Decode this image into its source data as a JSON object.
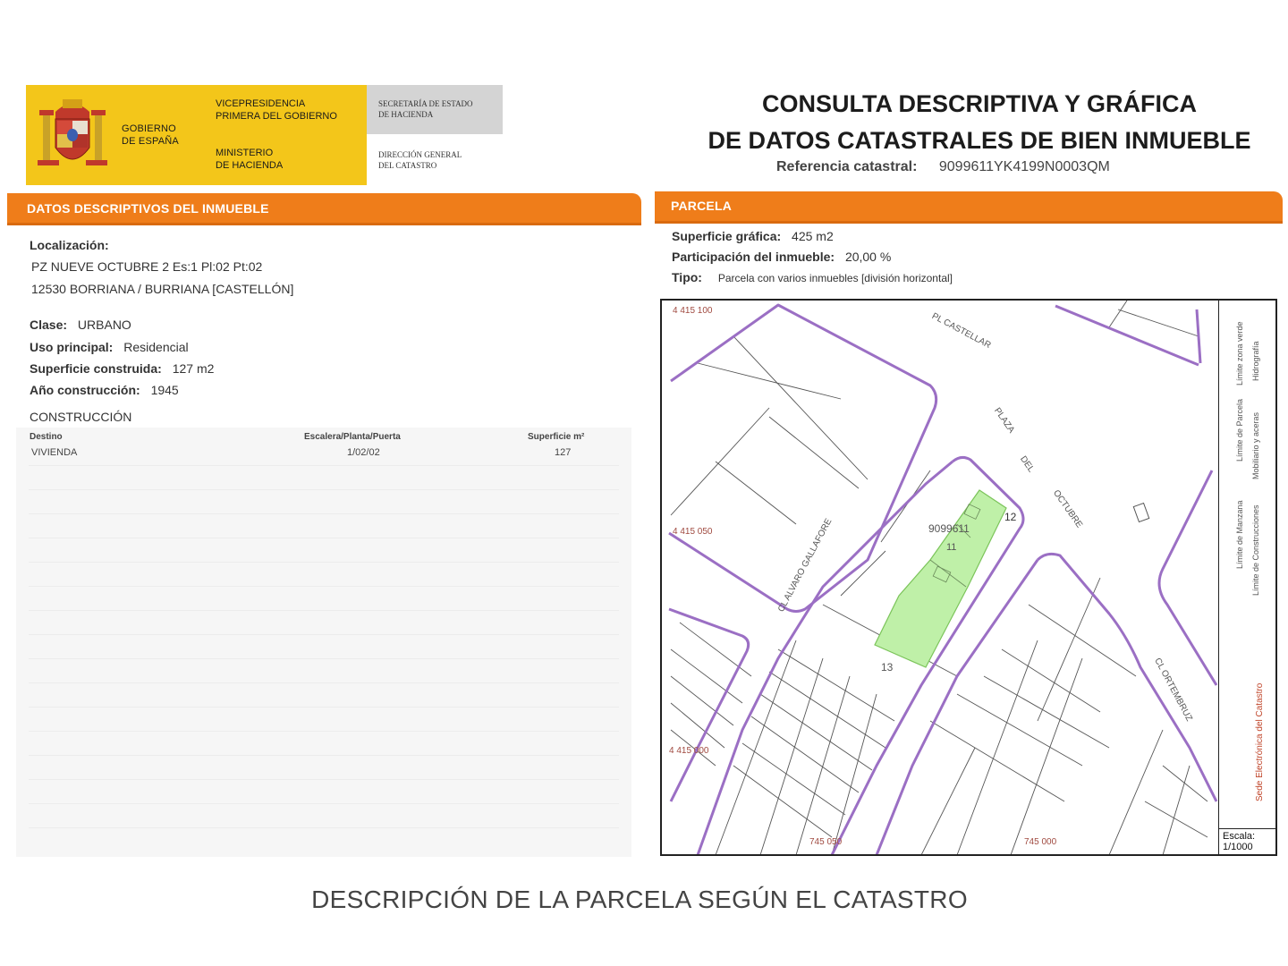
{
  "header": {
    "gov_line1": "GOBIERNO",
    "gov_line2": "DE ESPAÑA",
    "vice_line1": "VICEPRESIDENCIA",
    "vice_line2": "PRIMERA DEL GOBIERNO",
    "min_line1": "MINISTERIO",
    "min_line2": "DE HACIENDA",
    "sec_line1": "SECRETARÍA DE ESTADO",
    "sec_line2": "DE HACIENDA",
    "dir_line1": "DIRECCIÓN GENERAL",
    "dir_line2": "DEL CATASTRO",
    "colors": {
      "yellow": "#f3c61a",
      "grey": "#d4d4d4"
    }
  },
  "title": {
    "line1": "CONSULTA DESCRIPTIVA Y GRÁFICA",
    "line2": "DE DATOS CATASTRALES DE BIEN INMUEBLE",
    "ref_label": "Referencia catastral:",
    "ref_value": "9099611YK4199N0003QM"
  },
  "left": {
    "section_title": "DATOS DESCRIPTIVOS DEL INMUEBLE",
    "loc_label": "Localización:",
    "loc_line1": "PZ NUEVE OCTUBRE 2 Es:1 Pl:02 Pt:02",
    "loc_line2": "12530 BORRIANA / BURRIANA [CASTELLÓN]",
    "clase_label": "Clase:",
    "clase_value": "URBANO",
    "uso_label": "Uso principal:",
    "uso_value": "Residencial",
    "sup_label": "Superficie construida:",
    "sup_value": "127 m2",
    "ano_label": "Año construcción:",
    "ano_value": "1945",
    "constr_title": "CONSTRUCCIÓN",
    "table": {
      "headers": [
        "Destino",
        "Escalera/Planta/Puerta",
        "Superficie m²"
      ],
      "rows": [
        [
          "VIVIENDA",
          "1/02/02",
          "127"
        ]
      ]
    }
  },
  "right": {
    "section_title": "PARCELA",
    "sup_label": "Superficie gráfica:",
    "sup_value": "425 m2",
    "part_label": "Participación del inmueble:",
    "part_value": "20,00 %",
    "tipo_label": "Tipo:",
    "tipo_value": "Parcela con varios inmuebles [división horizontal]",
    "map": {
      "coord_top": "4 415 100",
      "coord_mid": "4 415 050",
      "coord_low": "4 415 000",
      "coord_b1": "745 050",
      "coord_b2": "745 000",
      "street_top": "PL CASTELLAR",
      "street_plaza_1": "PLAZA",
      "street_plaza_2": "DEL",
      "street_plaza_3": "OCTUBRE",
      "street_left": "CL ALVARO GALLAFORE",
      "street_right": "CL ORTEMBRUZ",
      "parcel_id": "9099611",
      "num_12": "12",
      "num_11": "11",
      "num_13": "13",
      "legend_1": "Límite de Manzana",
      "legend_2": "Límite de Parcela",
      "legend_3": "Límite de Construcciones",
      "legend_4": "Mobiliario y aceras",
      "legend_5": "Hidrografía",
      "legend_6": "Límite zona verde",
      "legend_red": "Sede Electrónica del Catastro",
      "scale_label": "Escala:",
      "scale_value": "1/1000",
      "colors": {
        "boundary": "#9b6fc4",
        "parcel": "#bff0a8",
        "parcel_edge": "#7bc45a"
      }
    }
  },
  "caption": "DESCRIPCIÓN DE LA PARCELA SEGÚN EL CATASTRO",
  "theme": {
    "orange": "#ef7d1a"
  }
}
